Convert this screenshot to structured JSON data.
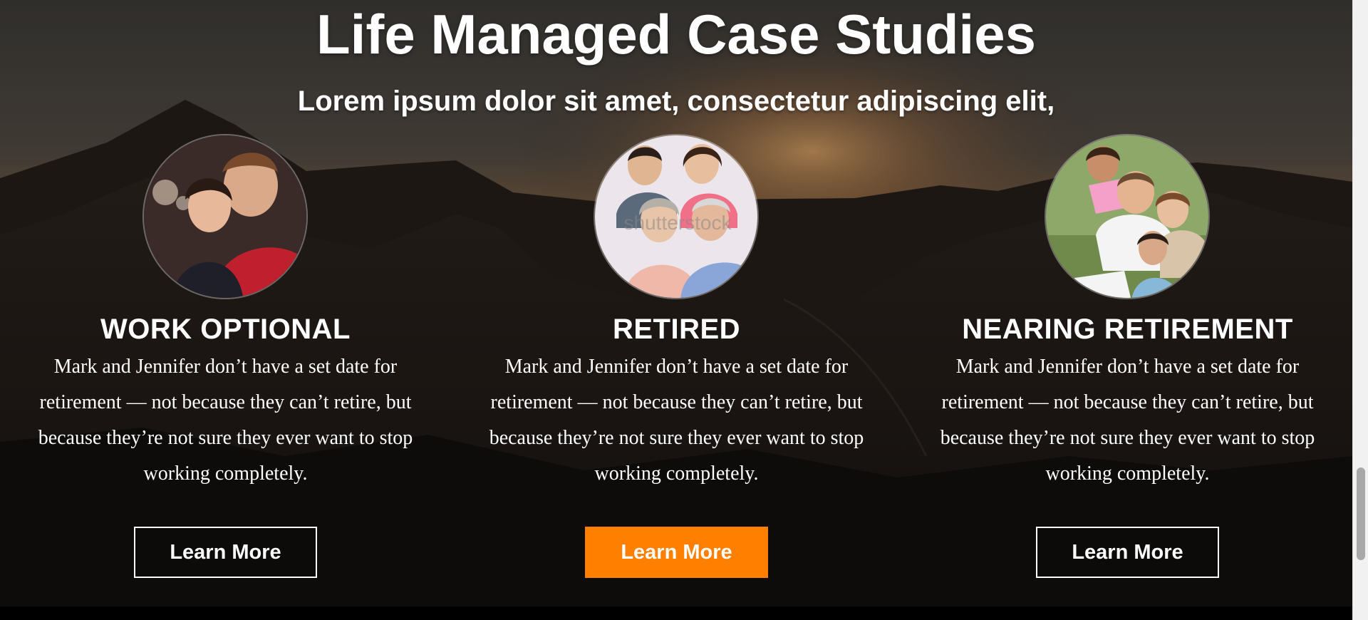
{
  "page": {
    "title": "Life Managed Case Studies",
    "subtitle": "Lorem ipsum dolor sit amet, consectetur adipiscing elit,"
  },
  "case_studies": [
    {
      "title": "WORK OPTIONAL",
      "text": "Mark and Jennifer don’t have a set date for retirement — not because they can’t retire, but because they’re not sure they ever want to stop working completely.",
      "button_label": "Learn More",
      "image_icon": "couple-photo"
    },
    {
      "title": "RETIRED",
      "text": "Mark and Jennifer don’t have a set date for retirement — not because they can’t retire, but because they’re not sure they ever want to stop working completely.",
      "button_label": "Learn More",
      "image_icon": "family-photo"
    },
    {
      "title": "NEARING RETIREMENT",
      "text": "Mark and Jennifer don’t have a set date for retirement — not because they can’t retire, but because they’re not sure they ever want to stop working completely.",
      "button_label": "Learn More",
      "image_icon": "kids-family-photo"
    }
  ],
  "colors": {
    "accent": "#ff7f00",
    "text": "#ffffff"
  }
}
